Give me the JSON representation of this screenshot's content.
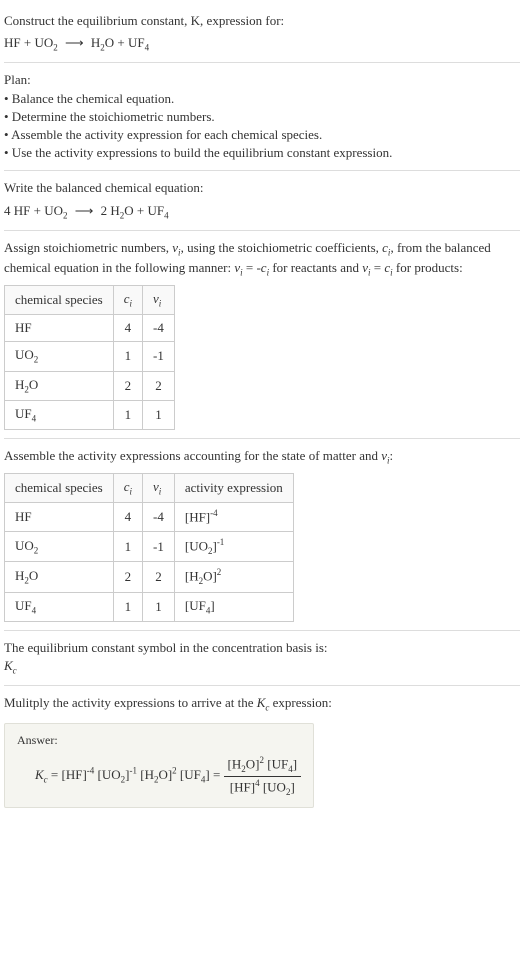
{
  "prompt": {
    "line1": "Construct the equilibrium constant, K, expression for:",
    "eq_lhs": "HF + UO",
    "eq_rhs1": "H",
    "eq_rhs2": "O + UF"
  },
  "plan": {
    "title": "Plan:",
    "item1": "• Balance the chemical equation.",
    "item2": "• Determine the stoichiometric numbers.",
    "item3": "• Assemble the activity expression for each chemical species.",
    "item4": "• Use the activity expressions to build the equilibrium constant expression."
  },
  "balanced": {
    "title": "Write the balanced chemical equation:"
  },
  "stoich": {
    "intro1": "Assign stoichiometric numbers, ",
    "intro2": ", using the stoichiometric coefficients, ",
    "intro3": ", from the balanced chemical equation in the following manner: ",
    "intro4": " for reactants and ",
    "intro5": " for products:",
    "th1": "chemical species",
    "th2": "cᵢ",
    "th3": "νᵢ",
    "rows": [
      {
        "species": "HF",
        "c": "4",
        "v": "-4"
      },
      {
        "species": "UO₂",
        "c": "1",
        "v": "-1"
      },
      {
        "species": "H₂O",
        "c": "2",
        "v": "2"
      },
      {
        "species": "UF₄",
        "c": "1",
        "v": "1"
      }
    ]
  },
  "activity": {
    "title": "Assemble the activity expressions accounting for the state of matter and νᵢ:",
    "th1": "chemical species",
    "th2": "cᵢ",
    "th3": "νᵢ",
    "th4": "activity expression",
    "rows": [
      {
        "species": "HF",
        "c": "4",
        "v": "-4",
        "expr_base": "[HF]",
        "expr_exp": "-4"
      },
      {
        "species": "UO₂",
        "c": "1",
        "v": "-1",
        "expr_base": "[UO₂]",
        "expr_exp": "-1"
      },
      {
        "species": "H₂O",
        "c": "2",
        "v": "2",
        "expr_base": "[H₂O]",
        "expr_exp": "2"
      },
      {
        "species": "UF₄",
        "c": "1",
        "v": "1",
        "expr_base": "[UF₄]",
        "expr_exp": ""
      }
    ]
  },
  "symbol": {
    "line": "The equilibrium constant symbol in the concentration basis is:",
    "kc": "K",
    "kc_sub": "c"
  },
  "final": {
    "title": "Mulitply the activity expressions to arrive at the Kc expression:",
    "answer_label": "Answer:"
  },
  "chart_data": {
    "type": "table",
    "title": "Stoichiometric numbers and activity expressions",
    "tables": [
      {
        "columns": [
          "chemical species",
          "c_i",
          "nu_i"
        ],
        "rows": [
          [
            "HF",
            4,
            -4
          ],
          [
            "UO2",
            1,
            -1
          ],
          [
            "H2O",
            2,
            2
          ],
          [
            "UF4",
            1,
            1
          ]
        ]
      },
      {
        "columns": [
          "chemical species",
          "c_i",
          "nu_i",
          "activity expression"
        ],
        "rows": [
          [
            "HF",
            4,
            -4,
            "[HF]^-4"
          ],
          [
            "UO2",
            1,
            -1,
            "[UO2]^-1"
          ],
          [
            "H2O",
            2,
            2,
            "[H2O]^2"
          ],
          [
            "UF4",
            1,
            1,
            "[UF4]"
          ]
        ]
      }
    ]
  }
}
